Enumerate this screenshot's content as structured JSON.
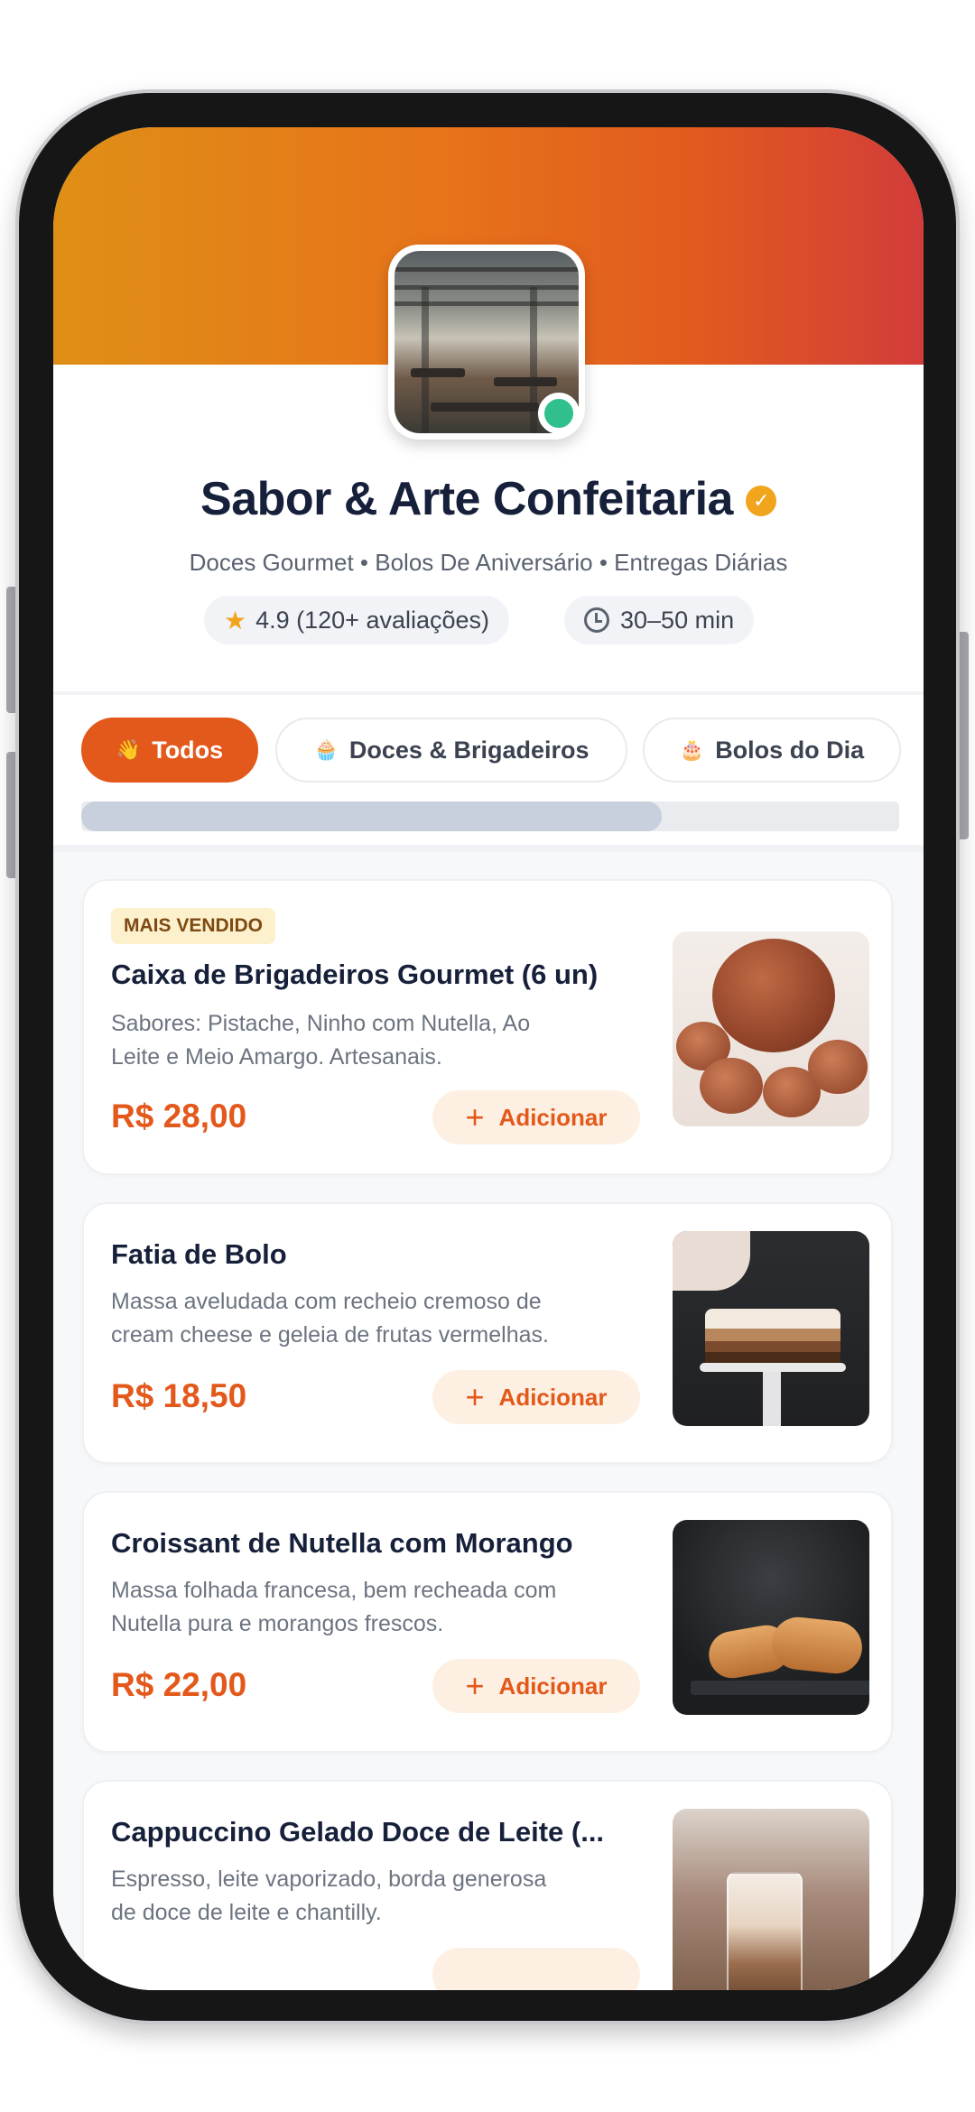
{
  "store": {
    "name": "Sabor & Arte Confeitaria",
    "verified_icon": "✓",
    "tagline": "Doces Gourmet • Bolos De Aniversário • Entregas Diárias",
    "rating": "4.9 (120+ avaliações)",
    "delivery_time": "30–50 min",
    "online": true
  },
  "tabs": [
    {
      "label": "Todos",
      "emoji": "👋",
      "active": true
    },
    {
      "label": "Doces & Brigadeiros",
      "emoji": "🧁",
      "active": false
    },
    {
      "label": "Bolos do Dia",
      "emoji": "🎂",
      "active": false
    }
  ],
  "tab_scroll_position": 0.71,
  "items": [
    {
      "badge": "MAIS VENDIDO",
      "title": "Caixa de Brigadeiros Gourmet (6 un)",
      "desc_line1": "Sabores: Pistache, Ninho com Nutella, Ao",
      "desc_line2": "Leite e Meio Amargo. Artesanais.",
      "price": "R$ 28,00",
      "add_label": "Adicionar"
    },
    {
      "badge": "",
      "title": "Fatia de Bolo",
      "desc_line1": "Massa aveludada com recheio cremoso de",
      "desc_line2": "cream cheese e geleia de frutas vermelhas.",
      "price": "R$ 18,50",
      "add_label": "Adicionar"
    },
    {
      "badge": "",
      "title": "Croissant de Nutella com Morango",
      "desc_line1": "Massa folhada francesa, bem recheada com",
      "desc_line2": "Nutella pura e morangos frescos.",
      "price": "R$ 22,00",
      "add_label": "Adicionar"
    },
    {
      "badge": "",
      "title": "Cappuccino Gelado Doce de Leite (...",
      "desc_line1": "Espresso, leite vaporizado, borda generosa",
      "desc_line2": "de doce de leite e chantilly.",
      "price": "",
      "add_label": ""
    }
  ],
  "colors": {
    "accent": "#e3581b",
    "header_gradient_start": "#df8f16",
    "header_gradient_end": "#d23c3a",
    "online_dot": "#2fc08c",
    "badge_bg": "#fdf0cc"
  },
  "icons": {
    "rating": "star-icon",
    "time": "clock-icon",
    "add": "plus-icon",
    "verified": "verified-badge-icon"
  }
}
